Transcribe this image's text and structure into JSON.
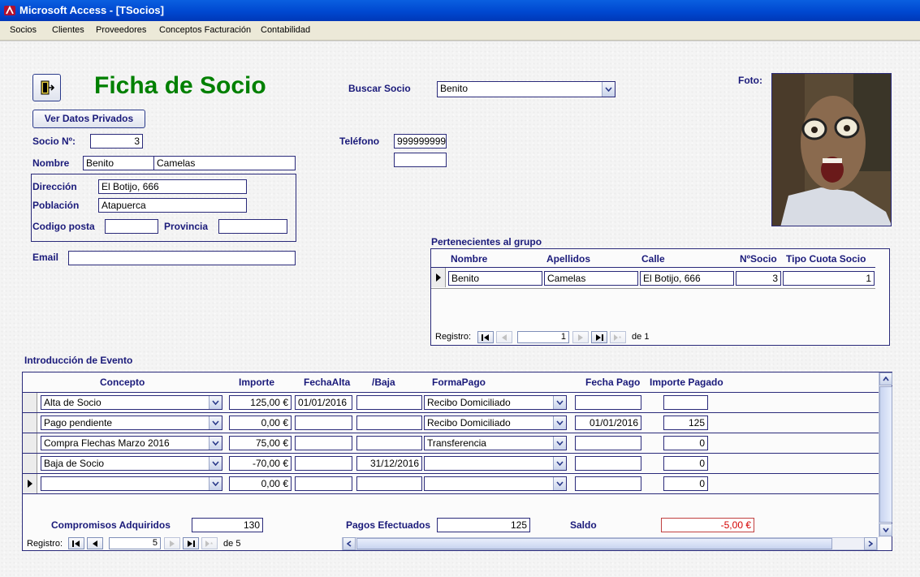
{
  "window": {
    "title": "Microsoft Access - [TSocios]"
  },
  "menu": [
    "Socios",
    "Clientes",
    "Proveedores",
    "Conceptos Facturación",
    "Contabilidad"
  ],
  "form": {
    "title": "Ficha de Socio",
    "exit_icon": "exit-door-icon",
    "ver_datos_label": "Ver Datos Privados",
    "buscar_label": "Buscar Socio",
    "buscar_value": "Benito",
    "foto_label": "Foto:",
    "socio_label": "Socio Nº:",
    "socio_value": "3",
    "telefono_label": "Teléfono",
    "telefono_value": "999999999",
    "telefono2_value": "",
    "nombre_label": "Nombre",
    "nombre_value": "Benito",
    "apellidos_value": "Camelas",
    "direccion_label": "Dirección",
    "direccion_value": "El Botijo, 666",
    "poblacion_label": "Población",
    "poblacion_value": "Atapuerca",
    "cp_label": "Codigo posta",
    "cp_value": "",
    "provincia_label": "Provincia",
    "provincia_value": "",
    "email_label": "Email",
    "email_value": ""
  },
  "grupo": {
    "title": "Pertenecientes al grupo",
    "headers": [
      "Nombre",
      "Apellidos",
      "Calle",
      "NºSocio",
      "Tipo Cuota Socio"
    ],
    "row": [
      "Benito",
      "Camelas",
      "El Botijo, 666",
      "3",
      "1"
    ],
    "nav": {
      "label": "Registro:",
      "current": "1",
      "of_label": "de",
      "total": "1"
    }
  },
  "eventos": {
    "title": "Introducción de Evento",
    "headers": [
      "Concepto",
      "Importe",
      "FechaAlta",
      "/Baja",
      "FormaPago",
      "Fecha Pago",
      "Importe Pagado"
    ],
    "rows": [
      {
        "concepto": "Alta de Socio",
        "importe": "125,00 €",
        "alta": "01/01/2016",
        "baja": "",
        "forma": "Recibo Domiciliado",
        "fecha_pago": "",
        "pagado": ""
      },
      {
        "concepto": "Pago pendiente",
        "importe": "0,00 €",
        "alta": "",
        "baja": "",
        "forma": "Recibo Domiciliado",
        "fecha_pago": "01/01/2016",
        "pagado": "125"
      },
      {
        "concepto": "Compra Flechas Marzo 2016",
        "importe": "75,00 €",
        "alta": "",
        "baja": "",
        "forma": "Transferencia",
        "fecha_pago": "",
        "pagado": "0"
      },
      {
        "concepto": "Baja de Socio",
        "importe": "-70,00 €",
        "alta": "",
        "baja": "31/12/2016",
        "forma": "",
        "fecha_pago": "",
        "pagado": "0"
      },
      {
        "concepto": "",
        "importe": "0,00 €",
        "alta": "",
        "baja": "",
        "forma": "",
        "fecha_pago": "",
        "pagado": "0"
      }
    ],
    "compromisos_label": "Compromisos Adquiridos",
    "compromisos_value": "130",
    "pagos_label": "Pagos Efectuados",
    "pagos_value": "125",
    "saldo_label": "Saldo",
    "saldo_value": "-5,00 €",
    "nav": {
      "label": "Registro:",
      "current": "5",
      "of_label": "de",
      "total": "5"
    }
  },
  "colors": {
    "label_blue": "#1a1a7a",
    "title_green": "#008000",
    "saldo_red": "#d40000"
  }
}
